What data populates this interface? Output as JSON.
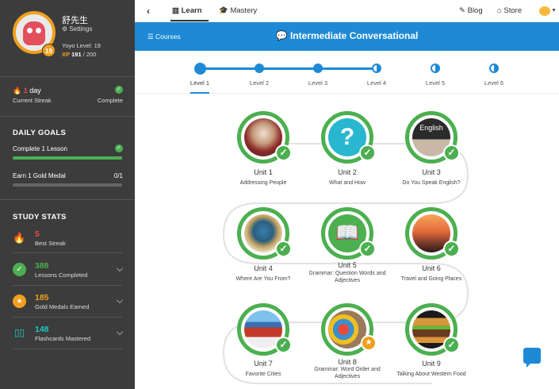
{
  "profile": {
    "name": "舒先生",
    "settings": "Settings",
    "yoyo_level": "Yoyo Level: 19",
    "level_badge": "19",
    "xp_label": "XP",
    "xp_value": "191",
    "xp_total": "/ 200"
  },
  "streak": {
    "count": "1",
    "unit": "day",
    "caption": "Current Streak",
    "status": "Complete"
  },
  "goals": {
    "title": "DAILY GOALS",
    "items": [
      {
        "label": "Complete 1 Lesson",
        "progress": 1.0,
        "done": true
      },
      {
        "label": "Earn 1 Gold Medal",
        "count": "0/1",
        "progress": 0.0
      }
    ]
  },
  "stats": {
    "title": "STUDY STATS",
    "items": [
      {
        "value": "5",
        "label": "Best Streak",
        "icon": "fire-icon",
        "color": "#e84b3c"
      },
      {
        "value": "388",
        "label": "Lessons Completed",
        "icon": "check-circle-icon",
        "color": "#4caf50"
      },
      {
        "value": "185",
        "label": "Gold Medals Earned",
        "icon": "medal-icon",
        "color": "#f0a01e"
      },
      {
        "value": "148",
        "label": "Flashcards Mastered",
        "icon": "flashcards-icon",
        "color": "#1ec8c8"
      }
    ]
  },
  "nav": {
    "learn": "Learn",
    "mastery": "Mastery",
    "blog": "Blog",
    "store": "Store"
  },
  "course": {
    "back_label": "Courses",
    "title": "Intermediate Conversational"
  },
  "levels": [
    "Level 1",
    "Level 2",
    "Level 3",
    "Level 4",
    "Level 5",
    "Level 6"
  ],
  "units": [
    {
      "title": "Unit 1",
      "subtitle": "Addressing People"
    },
    {
      "title": "Unit 2",
      "subtitle": "What and How"
    },
    {
      "title": "Unit 3",
      "subtitle": "Do You Speak English?"
    },
    {
      "title": "Unit 4",
      "subtitle": "Where Are You From?"
    },
    {
      "title": "Unit 5",
      "subtitle": "Grammar: Question Words and Adjectives"
    },
    {
      "title": "Unit 6",
      "subtitle": "Travel and Going Places"
    },
    {
      "title": "Unit 7",
      "subtitle": "Favorite Cities"
    },
    {
      "title": "Unit 8",
      "subtitle": "Grammar: Word Order and Adjectives"
    },
    {
      "title": "Unit 9",
      "subtitle": "Talking About Western Food"
    }
  ],
  "unit3_board_text": "English",
  "colors": {
    "accent": "#1e8ad6",
    "success": "#4caf50",
    "sidebar": "#3c3c3c",
    "gold": "#f0a01e"
  }
}
